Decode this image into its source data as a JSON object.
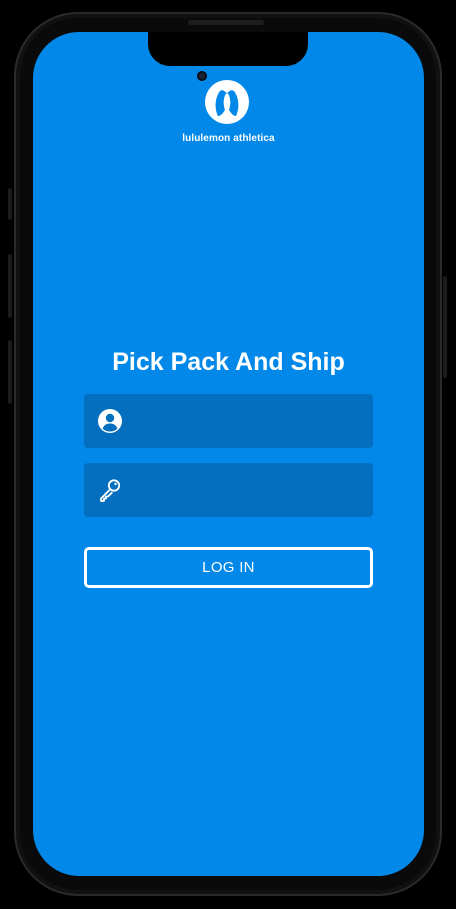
{
  "app": {
    "brand_text": "lululemon athletica",
    "logo_icon": "lululemon-logo-icon"
  },
  "login": {
    "title": "Pick Pack And Ship",
    "username_icon": "user-circle-icon",
    "username_value": "",
    "password_icon": "key-icon",
    "password_value": "",
    "login_button_label": "LOG IN"
  },
  "colors": {
    "background": "#0288e8",
    "field_background": "#036fbe",
    "text": "#ffffff"
  }
}
